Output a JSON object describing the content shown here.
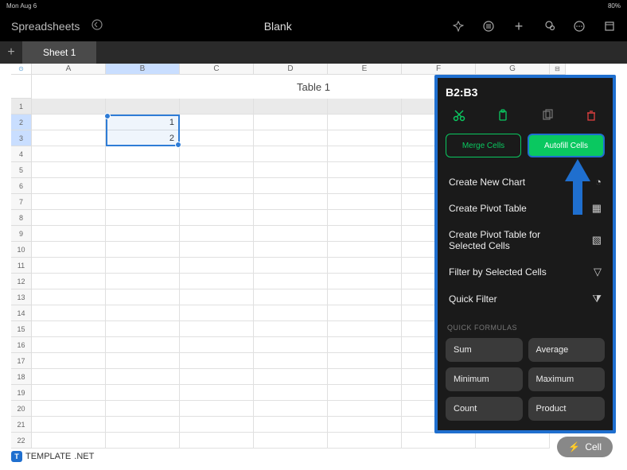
{
  "status": {
    "left": "Mon Aug 6",
    "right": "80%"
  },
  "toolbar": {
    "app_label": "Spreadsheets",
    "doc_title": "Blank"
  },
  "tabs": {
    "active": "Sheet 1"
  },
  "sheet": {
    "title": "Table 1",
    "cols": [
      "A",
      "B",
      "C",
      "D",
      "E",
      "F",
      "G"
    ],
    "selected_col": "B",
    "selected_rows": [
      2,
      3
    ],
    "data": {
      "B2": "1",
      "B3": "2"
    },
    "selection_range": "B2:B3",
    "row_count": 22
  },
  "panel": {
    "range": "B2:B3",
    "merge_label": "Merge Cells",
    "autofill_label": "Autofill Cells",
    "actions": [
      {
        "label": "Create New Chart",
        "icon": "clock"
      },
      {
        "label": "Create Pivot Table",
        "icon": "pivot"
      },
      {
        "label": "Create Pivot Table for Selected Cells",
        "icon": "pivot-sel"
      },
      {
        "label": "Filter by Selected Cells",
        "icon": "filter"
      },
      {
        "label": "Quick Filter",
        "icon": "quick-filter"
      }
    ],
    "formulas_header": "QUICK FORMULAS",
    "formulas": [
      "Sum",
      "Average",
      "Minimum",
      "Maximum",
      "Count",
      "Product"
    ]
  },
  "cell_pill": "Cell",
  "footer": {
    "brand": "TEMPLATE",
    "suffix": ".NET"
  }
}
